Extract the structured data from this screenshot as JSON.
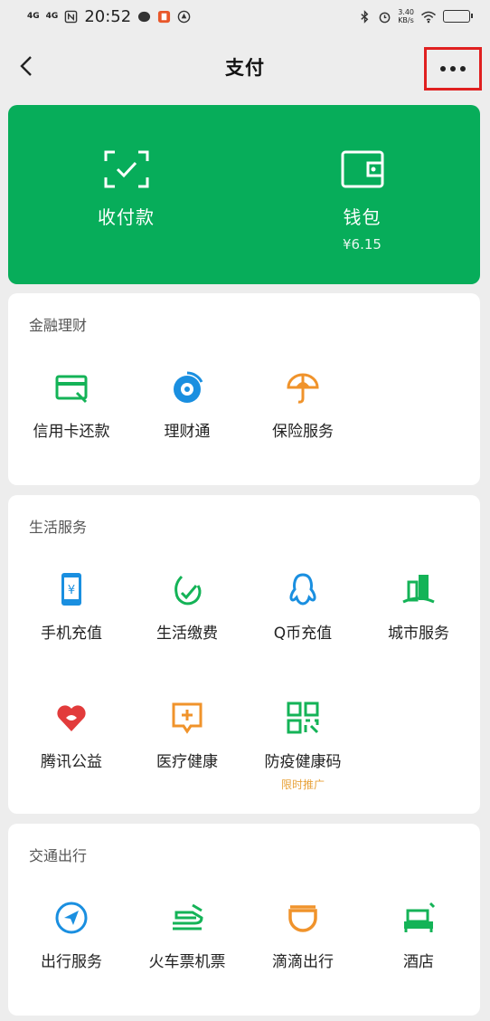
{
  "status_bar": {
    "signal1": "4G",
    "signal2": "4G",
    "time": "20:52",
    "speed": "3.40\nKB/s",
    "battery": "▯"
  },
  "header": {
    "title": "支付"
  },
  "hero": {
    "receive_pay_label": "收付款",
    "wallet_label": "钱包",
    "wallet_amount": "¥6.15"
  },
  "finance": {
    "title": "金融理财",
    "items": [
      {
        "label": "信用卡还款"
      },
      {
        "label": "理财通"
      },
      {
        "label": "保险服务"
      }
    ]
  },
  "life": {
    "title": "生活服务",
    "items": [
      {
        "label": "手机充值"
      },
      {
        "label": "生活缴费"
      },
      {
        "label": "Q币充值"
      },
      {
        "label": "城市服务"
      },
      {
        "label": "腾讯公益"
      },
      {
        "label": "医疗健康"
      },
      {
        "label": "防疫健康码",
        "sub": "限时推广"
      }
    ]
  },
  "transport": {
    "title": "交通出行",
    "items": [
      {
        "label": "出行服务"
      },
      {
        "label": "火车票机票"
      },
      {
        "label": "滴滴出行"
      },
      {
        "label": "酒店"
      }
    ]
  },
  "colors": {
    "brand_green": "#07ad5a",
    "icon_green": "#14b357",
    "icon_blue": "#1a8fe0",
    "icon_orange": "#f0932b",
    "icon_red": "#e23b3b",
    "highlight_red": "#e02020"
  }
}
